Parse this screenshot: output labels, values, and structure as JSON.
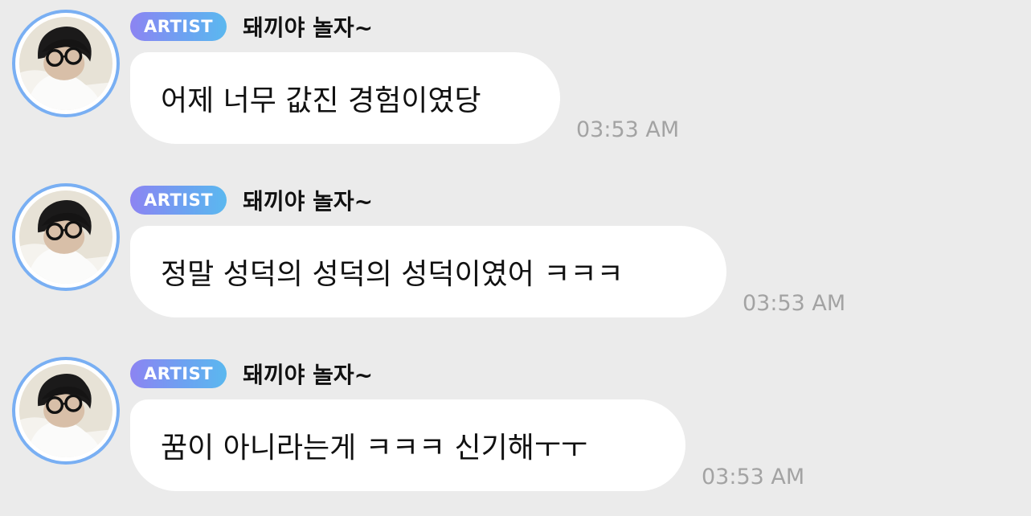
{
  "messages": [
    {
      "badge": "ARTIST",
      "sender": "돼끼야 놀자~",
      "text": "어제 너무 값진 경험이였당",
      "time": "03:53 AM"
    },
    {
      "badge": "ARTIST",
      "sender": "돼끼야 놀자~",
      "text": "정말 성덕의 성덕의 성덕이였어 ㅋㅋㅋ",
      "time": "03:53 AM"
    },
    {
      "badge": "ARTIST",
      "sender": "돼끼야 놀자~",
      "text": "꿈이 아니라는게 ㅋㅋㅋ 신기해ㅜㅜ",
      "time": "03:53 AM"
    }
  ],
  "colors": {
    "background": "#ebebeb",
    "bubble": "#ffffff",
    "avatar_ring": "#79aff3",
    "badge_gradient_start": "#8c84f2",
    "badge_gradient_end": "#5bb8ef",
    "timestamp": "#a3a3a3"
  },
  "icons": {
    "avatar": "profile-photo"
  }
}
